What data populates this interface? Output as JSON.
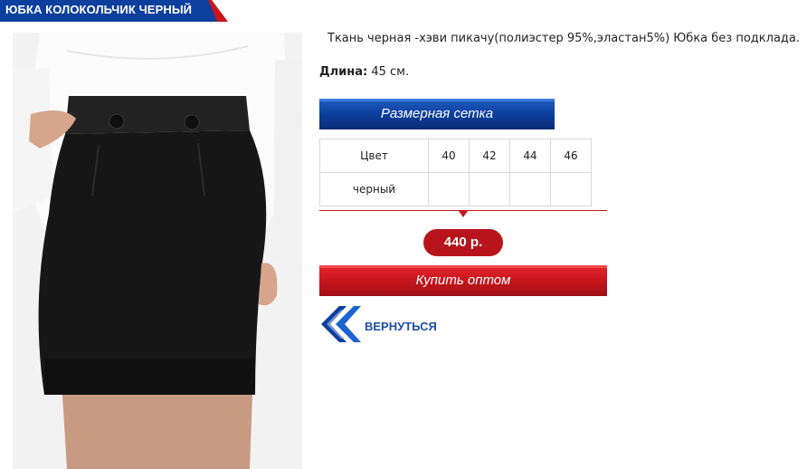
{
  "product": {
    "title": "ЮБКА КОЛОКОЛЬЧИК ЧЕРНЫЙ",
    "description": "Ткань черная -хэви пикачу(полиэстер 95%,эластан5%) Юбка без подклада.",
    "length_label": "Длина:",
    "length_value": "45 см.",
    "price": "440 р."
  },
  "size_chart": {
    "button_label": "Размерная сетка",
    "header": [
      "Цвет",
      "40",
      "42",
      "44",
      "46"
    ],
    "rows": [
      [
        "черный",
        "",
        "",
        "",
        ""
      ]
    ]
  },
  "actions": {
    "buy_label": "Купить оптом",
    "back_label": "ВЕРНУТЬСЯ"
  },
  "colors": {
    "brand_blue": "#0d3f9e",
    "accent_red": "#c8161d",
    "price_red": "#b7151b",
    "link_blue": "#1d4fa6"
  },
  "icons": {
    "back": "double-chevron-left-icon"
  }
}
